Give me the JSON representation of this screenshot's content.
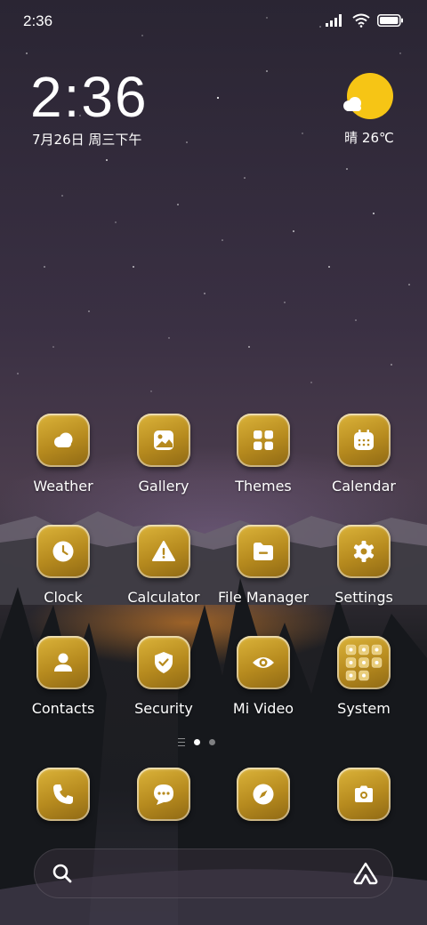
{
  "status_bar": {
    "time": "2:36",
    "icons": [
      "signal-icon",
      "wifi-icon",
      "battery-icon"
    ]
  },
  "clock_widget": {
    "time": "2:36",
    "date": "7月26日 周三下午"
  },
  "weather_widget": {
    "text": "晴 26℃",
    "icon": "sun-cloud-icon"
  },
  "apps": [
    {
      "label": "Weather",
      "icon": "weather-icon"
    },
    {
      "label": "Gallery",
      "icon": "gallery-icon"
    },
    {
      "label": "Themes",
      "icon": "themes-icon"
    },
    {
      "label": "Calendar",
      "icon": "calendar-icon"
    },
    {
      "label": "Clock",
      "icon": "clock-icon"
    },
    {
      "label": "Calculator",
      "icon": "calculator-icon"
    },
    {
      "label": "File Manager",
      "icon": "file-manager-icon"
    },
    {
      "label": "Settings",
      "icon": "gear-icon"
    },
    {
      "label": "Contacts",
      "icon": "contacts-icon"
    },
    {
      "label": "Security",
      "icon": "shield-icon"
    },
    {
      "label": "Mi Video",
      "icon": "eye-icon"
    },
    {
      "label": "System",
      "icon": "folder-icon"
    }
  ],
  "dock": [
    {
      "icon": "phone-icon"
    },
    {
      "icon": "messages-icon"
    },
    {
      "icon": "compass-icon"
    },
    {
      "icon": "camera-icon"
    }
  ],
  "pager": {
    "pages": 2,
    "current": 1
  },
  "colors": {
    "icon_gold": "#c99c28",
    "sun": "#f6c515"
  }
}
